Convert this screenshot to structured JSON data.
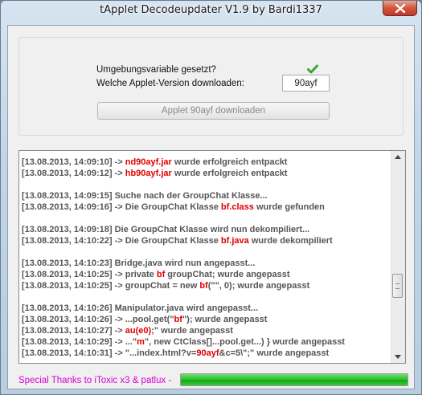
{
  "window": {
    "title": "tApplet Decodeupdater V1.9 by Bardi1337"
  },
  "top_panel": {
    "env_label": "Umgebungsvariable gesetzt?",
    "env_status_icon": "checkmark-icon",
    "version_label": "Welche Applet-Version downloaden:",
    "version_value": "90ayf",
    "download_button": "Applet 90ayf downloaden"
  },
  "log": {
    "lines": [
      [
        {
          "t": "[13.08.2013, 14:09:10] -> "
        },
        {
          "t": "nd90ayf.jar",
          "h": true
        },
        {
          "t": " wurde erfolgreich entpackt"
        }
      ],
      [
        {
          "t": "[13.08.2013, 14:09:12] -> "
        },
        {
          "t": "hb90ayf.jar",
          "h": true
        },
        {
          "t": " wurde erfolgreich entpackt"
        }
      ],
      [],
      [
        {
          "t": "[13.08.2013, 14:09:15] Suche nach der GroupChat Klasse..."
        }
      ],
      [
        {
          "t": "[13.08.2013, 14:09:16] -> Die GroupChat Klasse "
        },
        {
          "t": "bf.class",
          "h": true
        },
        {
          "t": " wurde gefunden"
        }
      ],
      [],
      [
        {
          "t": "[13.08.2013, 14:09:18] Die GroupChat Klasse wird nun dekompiliert..."
        }
      ],
      [
        {
          "t": "[13.08.2013, 14:10:22] -> Die GroupChat Klasse "
        },
        {
          "t": "bf.java",
          "h": true
        },
        {
          "t": " wurde dekompiliert"
        }
      ],
      [],
      [
        {
          "t": "[13.08.2013, 14:10:23] Bridge.java wird nun angepasst..."
        }
      ],
      [
        {
          "t": "[13.08.2013, 14:10:25] -> private "
        },
        {
          "t": "bf",
          "h": true
        },
        {
          "t": " groupChat; wurde angepasst"
        }
      ],
      [
        {
          "t": "[13.08.2013, 14:10:25] -> groupChat = new "
        },
        {
          "t": "bf",
          "h": true
        },
        {
          "t": "(\"\", 0); wurde angepasst"
        }
      ],
      [],
      [
        {
          "t": "[13.08.2013, 14:10:26] Manipulator.java wird angepasst..."
        }
      ],
      [
        {
          "t": "[13.08.2013, 14:10:26] -> ...pool.get(\""
        },
        {
          "t": "bf",
          "h": true
        },
        {
          "t": "\"); wurde angepasst"
        }
      ],
      [
        {
          "t": "[13.08.2013, 14:10:27] -> "
        },
        {
          "t": "au(e0)",
          "h": true
        },
        {
          "t": ";\" wurde angepasst"
        }
      ],
      [
        {
          "t": "[13.08.2013, 14:10:29] -> ...\""
        },
        {
          "t": "m",
          "h": true
        },
        {
          "t": "\", new CtClass[]...pool.get...) } wurde angepasst"
        }
      ],
      [
        {
          "t": "[13.08.2013, 14:10:31] -> \"...index.html?v="
        },
        {
          "t": "90ayf",
          "h": true
        },
        {
          "t": "&c=5\\\";\" wurde angepasst"
        }
      ]
    ]
  },
  "footer": {
    "thanks_text": "Special Thanks to iToxic x3 & patlux -",
    "progress_percent": 100
  },
  "colors": {
    "highlight": "#e00000",
    "log_text": "#555555",
    "footer_text": "#d400d4",
    "progress": "#2fc12f",
    "check": "#3aa63a"
  }
}
